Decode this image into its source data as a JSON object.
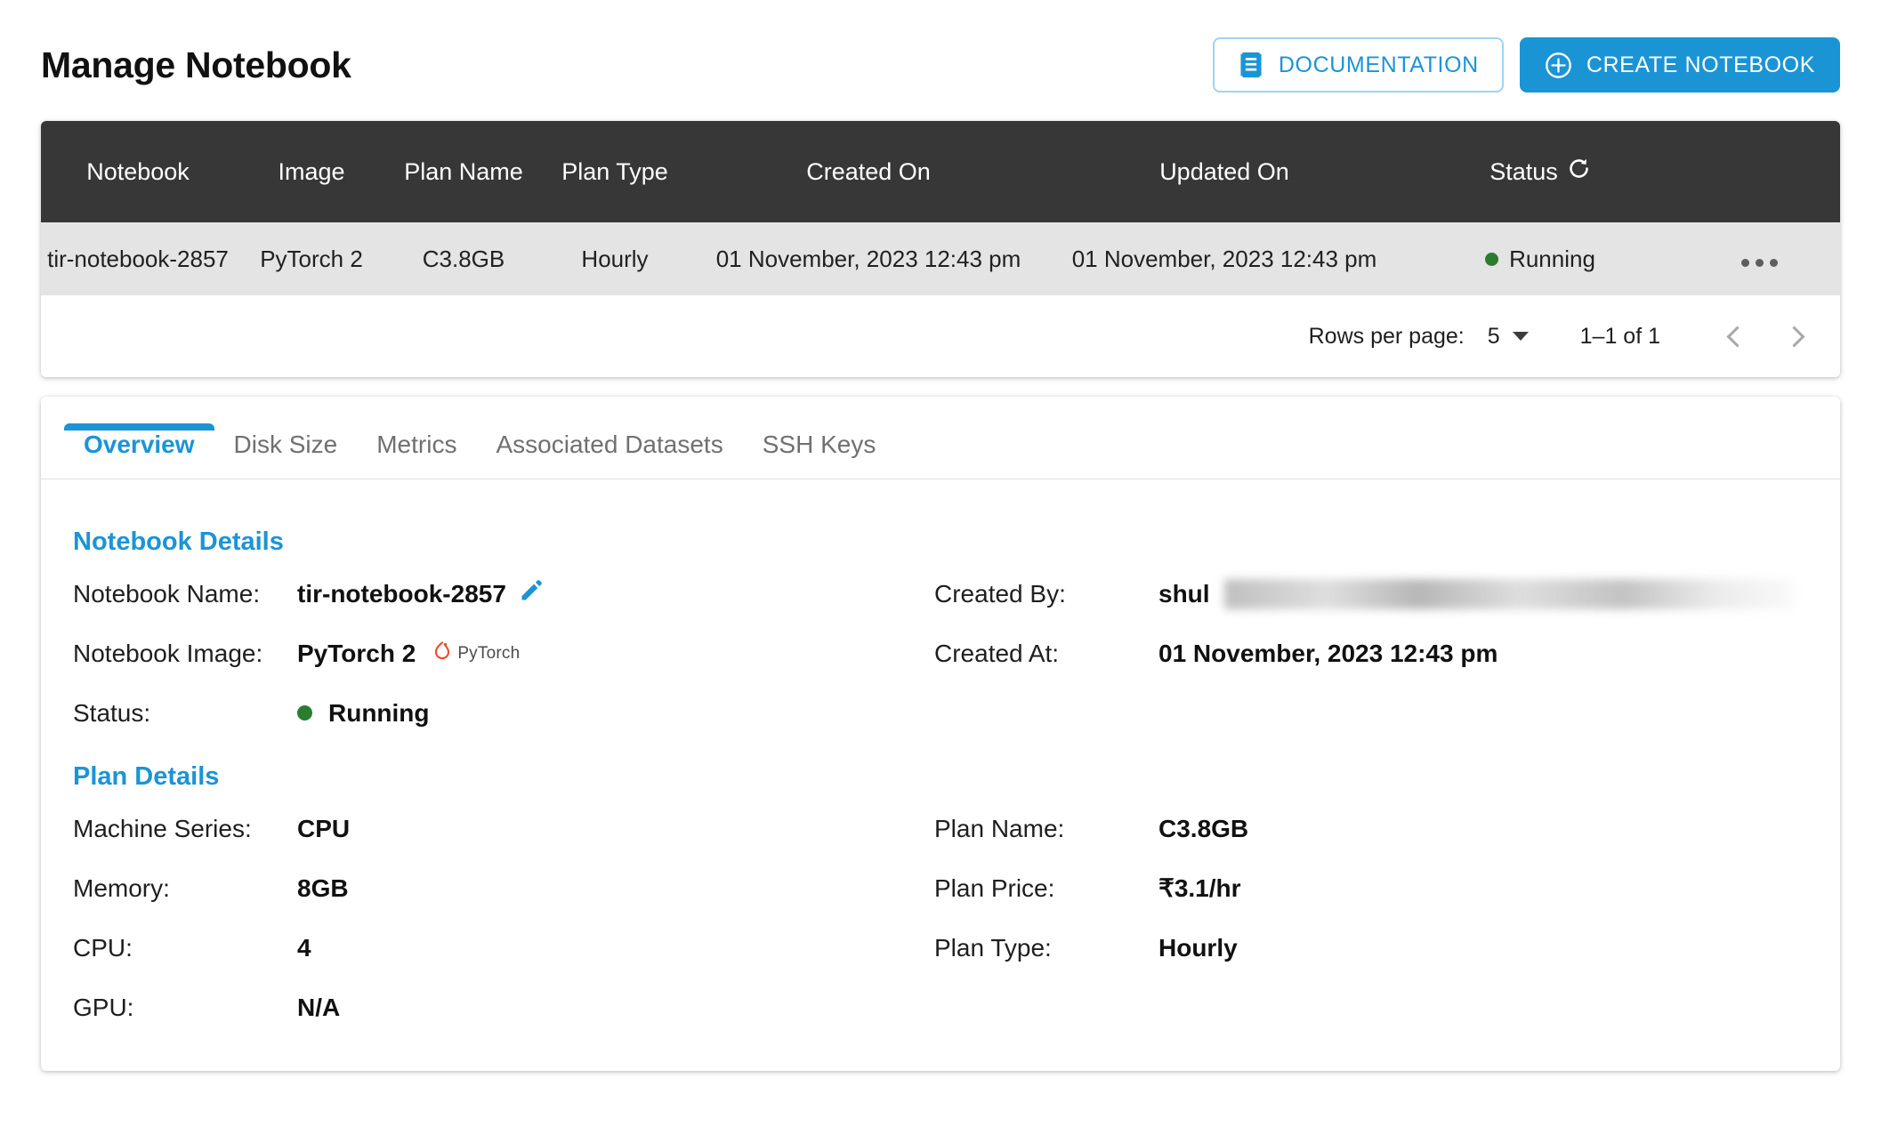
{
  "header": {
    "title": "Manage Notebook",
    "documentation_button": "DOCUMENTATION",
    "create_button": "CREATE NOTEBOOK",
    "doc_icon": "article-icon",
    "create_icon": "plus-circle-icon",
    "accent_color": "#1b94d6"
  },
  "table": {
    "columns": [
      "Notebook",
      "Image",
      "Plan Name",
      "Plan Type",
      "Created On",
      "Updated On",
      "Status"
    ],
    "refresh_icon": "refresh-icon",
    "rows": [
      {
        "notebook": "tir-notebook-2857",
        "image": "PyTorch 2",
        "plan_name": "C3.8GB",
        "plan_type": "Hourly",
        "created_on": "01 November, 2023 12:43 pm",
        "updated_on": "01 November, 2023 12:43 pm",
        "status": "Running",
        "status_color": "#2a7d2e",
        "menu_icon": "kebab-menu-icon"
      }
    ],
    "header_bg": "#373737",
    "row_bg": "#e4e4e4"
  },
  "pagination": {
    "rows_per_page_label": "Rows per page:",
    "rows_per_page_value": "5",
    "range": "1–1 of 1",
    "prev_icon": "chevron-left-icon",
    "next_icon": "chevron-right-icon"
  },
  "tabs": [
    {
      "label": "Overview",
      "active": true
    },
    {
      "label": "Disk Size",
      "active": false
    },
    {
      "label": "Metrics",
      "active": false
    },
    {
      "label": "Associated Datasets",
      "active": false
    },
    {
      "label": "SSH Keys",
      "active": false
    }
  ],
  "overview": {
    "notebook_details_title": "Notebook Details",
    "plan_details_title": "Plan Details",
    "labels": {
      "notebook_name": "Notebook Name:",
      "notebook_image": "Notebook Image:",
      "status": "Status:",
      "created_by": "Created By:",
      "created_at": "Created At:",
      "machine_series": "Machine Series:",
      "memory": "Memory:",
      "cpu": "CPU:",
      "gpu": "GPU:",
      "plan_name": "Plan Name:",
      "plan_price": "Plan Price:",
      "plan_type": "Plan Type:"
    },
    "values": {
      "notebook_name": "tir-notebook-2857",
      "notebook_image": "PyTorch 2",
      "image_logo_text": "PyTorch",
      "status": "Running",
      "status_color": "#2a7d2e",
      "created_by": "shul",
      "created_at": "01 November, 2023 12:43 pm",
      "machine_series": "CPU",
      "memory": "8GB",
      "cpu": "4",
      "gpu": "N/A",
      "plan_name": "C3.8GB",
      "plan_price": "₹3.1/hr",
      "plan_type": "Hourly"
    },
    "edit_icon": "edit-pencil-icon"
  }
}
